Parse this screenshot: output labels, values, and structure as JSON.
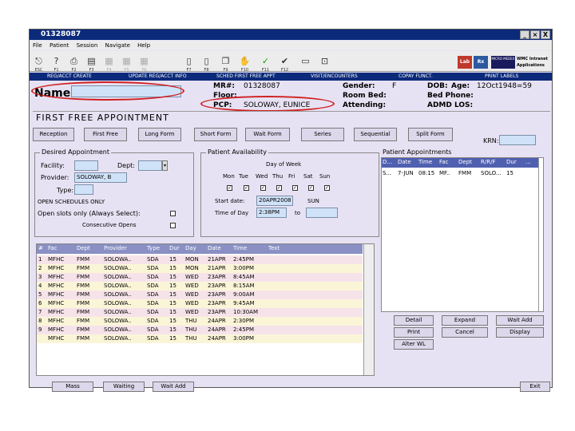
{
  "window": {
    "title": "01328087",
    "buttons": [
      "_",
      "×",
      "X"
    ]
  },
  "menu": [
    "File",
    "Patient",
    "Session",
    "Navigate",
    "Help"
  ],
  "toolbar": {
    "items": [
      {
        "label": "ESC"
      },
      {
        "label": "F1"
      },
      {
        "label": "F2"
      },
      {
        "label": "F3"
      },
      {
        "label": "F4"
      },
      {
        "label": "F5"
      },
      {
        "label": "F6"
      },
      {
        "label": "F7"
      },
      {
        "label": "F8"
      },
      {
        "label": "F9"
      },
      {
        "label": "F10"
      },
      {
        "label": "F11"
      },
      {
        "label": "F12"
      }
    ],
    "right_labels": {
      "lab": "Lab",
      "rx": "Rx",
      "micro": "MICRO MEDEX",
      "intranet": "WMC Intranet Applications"
    }
  },
  "nav": [
    "REG/ACCT CREATE",
    "UPDATE REG/ACCT INFO",
    "SCHED FIRST FREE APPT",
    "VISIT/ENCOUNTERS",
    "COPAY FUNCT.",
    "PRINT LABELS"
  ],
  "patient": {
    "name_label": "Name:",
    "mr_label": "MR#:",
    "mr_value": "01328087",
    "floor_label": "Floor:",
    "pcp_label": "PCP:",
    "pcp_value": "SOLOWAY, EUNICE",
    "gender_label": "Gender:",
    "gender_value": "F",
    "room_label": "Room Bed:",
    "attending_label": "Attending:",
    "dob_label": "DOB:",
    "age_label": "Age:",
    "dob_value": "12Oct1948=59",
    "bed_phone_label": "Bed Phone:",
    "admd_label": "ADMD LOS:"
  },
  "section_title": "FIRST FREE APPOINTMENT",
  "tabs": [
    "Reception",
    "First Free",
    "Long Form",
    "Short Form",
    "Wait Form",
    "Series",
    "Sequential",
    "Split Form"
  ],
  "krn_label": "KRN:",
  "desired": {
    "title": "Desired Appointment",
    "facility_label": "Facility:",
    "dept_label": "Dept:",
    "provider_label": "Provider:",
    "provider_value": "SOLOWAY, B",
    "type_label": "Type:",
    "open_schedules": "OPEN SCHEDULES ONLY",
    "open_slots": "Open slots only (Always Select):",
    "consecutive": "Consecutive Opens"
  },
  "availability": {
    "title": "Patient Availability",
    "dow_label": "Day of Week",
    "days": [
      "Mon",
      "Tue",
      "Wed",
      "Thu",
      "Fri",
      "Sat",
      "Sun"
    ],
    "start_label": "Start date:",
    "start_value": "20APR2008",
    "start_day": "SUN",
    "time_label": "Time of Day",
    "time_value": "2:38PM",
    "to_label": "to"
  },
  "appointments": {
    "title": "Patient Appointments",
    "headers": [
      "D...",
      "Date",
      "Time",
      "Fac",
      "Dept",
      "R/R/F",
      "Dur",
      "..."
    ],
    "rows": [
      [
        "S...",
        "7-JUN",
        "08:15",
        "MF..",
        "FMM",
        "SOLO...",
        "15",
        ""
      ]
    ],
    "buttons": [
      "Detail",
      "Expand",
      "Wait Add",
      "Print",
      "Cancel",
      "Display",
      "Alter WL"
    ]
  },
  "results": {
    "headers": [
      "#",
      "Fac",
      "Dept",
      "Provider",
      "Type",
      "Dur",
      "Day",
      "Date",
      "Time",
      "Text"
    ],
    "rows": [
      [
        "1",
        "MFHC",
        "FMM",
        "SOLOWA..",
        "SDA",
        "15",
        "MON",
        "21APR",
        "2:45PM",
        ""
      ],
      [
        "2",
        "MFHC",
        "FMM",
        "SOLOWA..",
        "SDA",
        "15",
        "MON",
        "21APR",
        "3:00PM",
        ""
      ],
      [
        "3",
        "MFHC",
        "FMM",
        "SOLOWA..",
        "SDA",
        "15",
        "WED",
        "23APR",
        "8:45AM",
        ""
      ],
      [
        "4",
        "MFHC",
        "FMM",
        "SOLOWA..",
        "SDA",
        "15",
        "WED",
        "23APR",
        "8:15AM",
        ""
      ],
      [
        "5",
        "MFHC",
        "FMM",
        "SOLOWA..",
        "SDA",
        "15",
        "WED",
        "23APR",
        "9:00AM",
        ""
      ],
      [
        "6",
        "MFHC",
        "FMM",
        "SOLOWA..",
        "SDA",
        "15",
        "WED",
        "23APR",
        "9:45AM",
        ""
      ],
      [
        "7",
        "MFHC",
        "FMM",
        "SOLOWA..",
        "SDA",
        "15",
        "WED",
        "23APR",
        "10:30AM",
        ""
      ],
      [
        "8",
        "MFHC",
        "FMM",
        "SOLOWA..",
        "SDA",
        "15",
        "THU",
        "24APR",
        "2:30PM",
        ""
      ],
      [
        "9",
        "MFHC",
        "FMM",
        "SOLOWA..",
        "SDA",
        "15",
        "THU",
        "24APR",
        "2:45PM",
        ""
      ],
      [
        "",
        "MFHC",
        "FMM",
        "SOLOWA..",
        "SDA",
        "15",
        "THU",
        "24APR",
        "3:00PM",
        ""
      ]
    ]
  },
  "bottom_buttons": [
    "Mass",
    "Waiting",
    "Wait Add",
    "Exit"
  ],
  "colors": {
    "title_bar": "#0b2a7a",
    "window_bg": "#e7e2f3",
    "highlight": "#d02020",
    "row_pink": "#f6e3ea",
    "row_yellow": "#fbf5d8"
  }
}
